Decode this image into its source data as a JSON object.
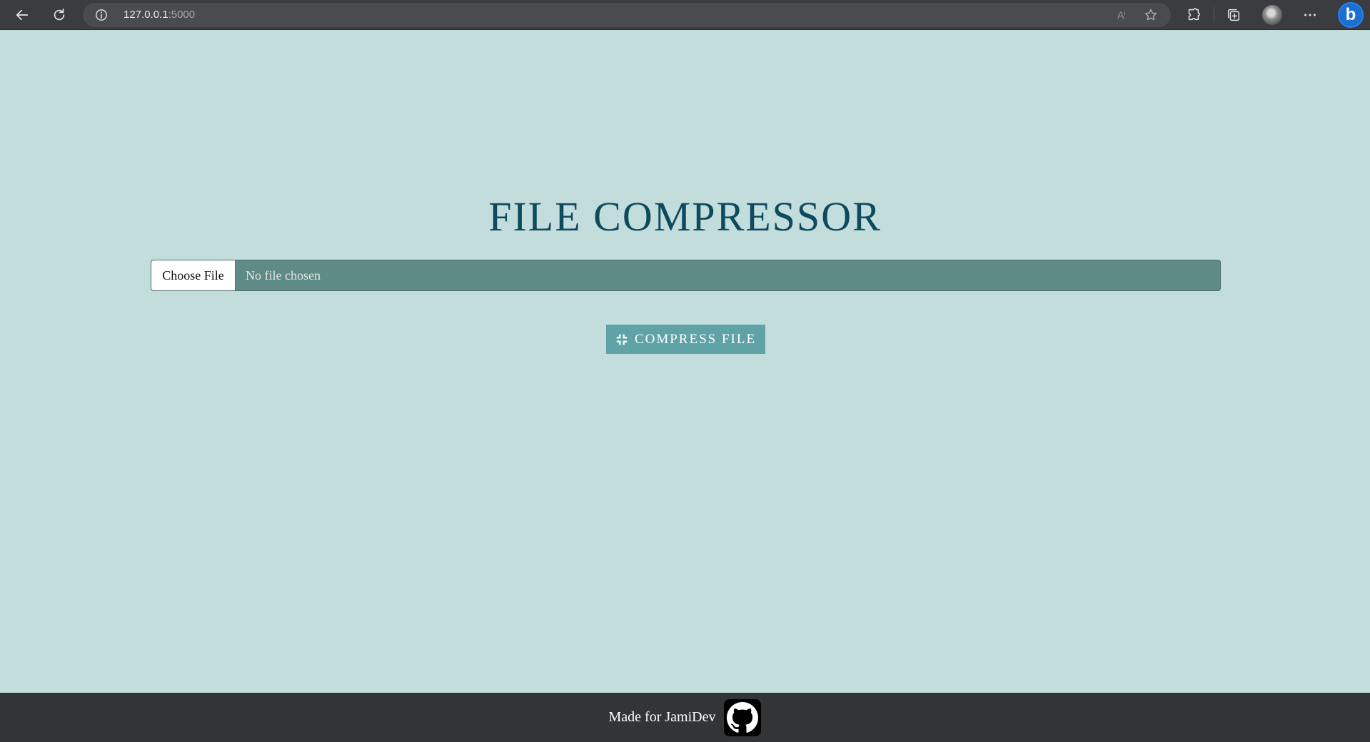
{
  "browser": {
    "url_host": "127.0.0.1",
    "url_port": ":5000",
    "read_aloud_label": "Aⁱ"
  },
  "page": {
    "title": "FILE COMPRESSOR",
    "file_input": {
      "button_label": "Choose File",
      "status_text": "No file chosen"
    },
    "compress_button_label": "COMPRESS FILE",
    "compress_icon": "compress-arrows-icon"
  },
  "footer": {
    "credit_text": "Made for JamiDev",
    "link_icon": "github-icon"
  },
  "colors": {
    "page_background": "#c3dddd",
    "title": "#0c4a5e",
    "file_input_background": "#5f8b86",
    "compress_button": "#5fa3a7",
    "footer_background": "#333436"
  }
}
